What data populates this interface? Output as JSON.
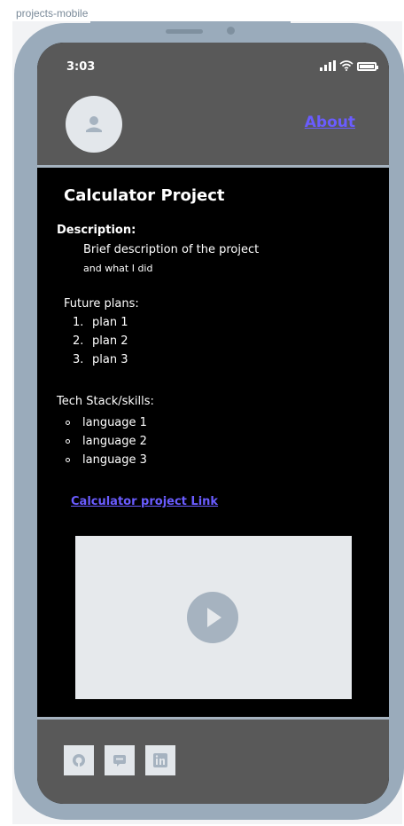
{
  "frame": {
    "label": "projects-mobile"
  },
  "status": {
    "time": "3:03"
  },
  "header": {
    "about": "About"
  },
  "project": {
    "title": "Calculator Project",
    "description_label": "Description:",
    "description_lines": [
      "Brief description of the project",
      "and what I did"
    ],
    "plans_label": "Future plans:",
    "plans": [
      {
        "num": "1.",
        "text": "plan 1"
      },
      {
        "num": "2.",
        "text": "plan 2"
      },
      {
        "num": "3.",
        "text": "plan 3"
      }
    ],
    "tech_label": "Tech Stack/skills:",
    "tech": [
      "language 1",
      "language 2",
      "language 3"
    ],
    "link_text": "Calculator project Link"
  },
  "icons": {
    "avatar": "user-icon",
    "play": "play-icon",
    "socials": [
      "github-icon",
      "chat-icon",
      "linkedin-icon"
    ]
  },
  "colors": {
    "link": "#6a5cff",
    "shell": "#9aabbb",
    "panel": "#595959",
    "screen": "#000000"
  }
}
